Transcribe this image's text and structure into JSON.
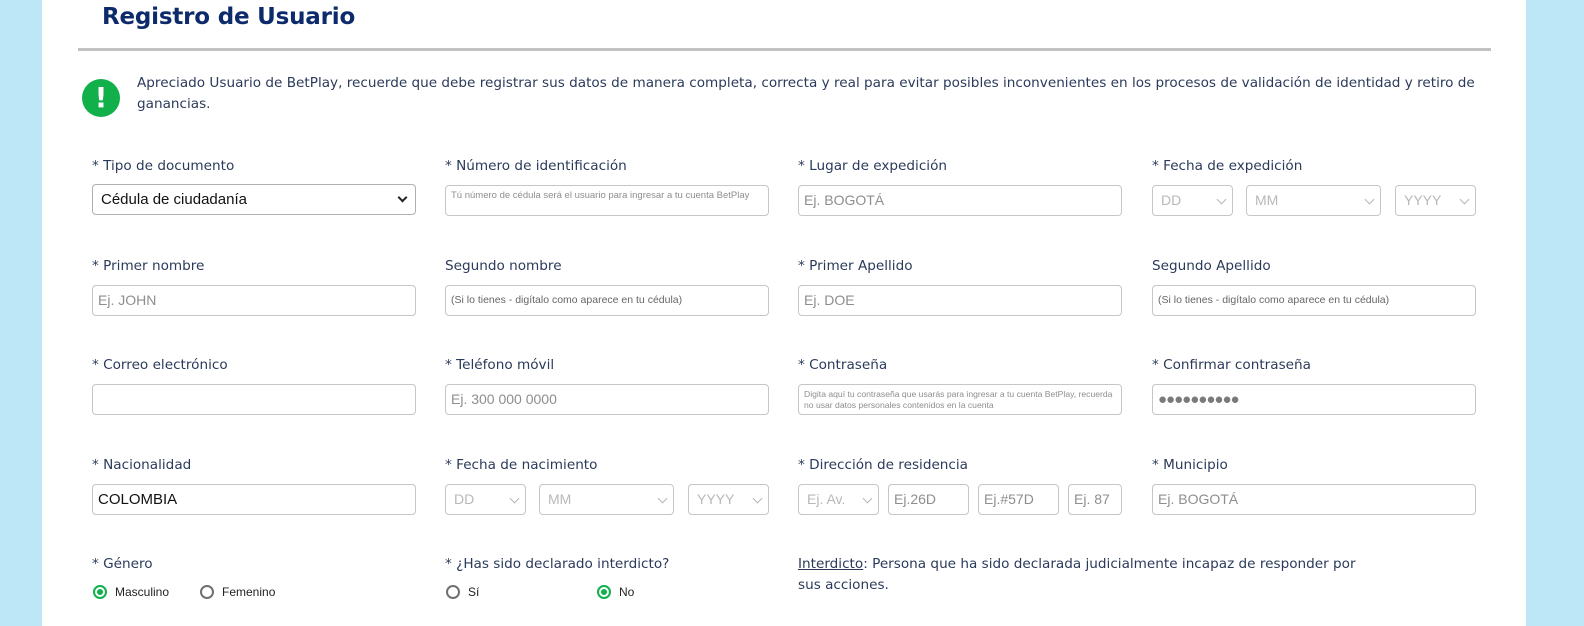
{
  "header": {
    "title": "Registro de Usuario"
  },
  "alert": {
    "icon": "exclamation-icon",
    "text": "Apreciado Usuario de BetPlay, recuerde que debe registrar sus datos de manera completa, correcta y real para evitar posibles inconvenientes en los procesos de validación de identidad y retiro de ganancias."
  },
  "colors": {
    "brand_dark_blue": "#0d2b6b",
    "accent_green": "#11b04a",
    "side_background": "#bde6f6"
  },
  "form": {
    "tipo_documento": {
      "label": "* Tipo de documento",
      "value": "Cédula de ciudadanía"
    },
    "numero_identificacion": {
      "label": "* Número de identificación",
      "placeholder": "Tú número de cédula será el usuario para ingresar a tu cuenta BetPlay"
    },
    "lugar_expedicion": {
      "label": "* Lugar de expedición",
      "placeholder": "Ej. BOGOTÁ"
    },
    "fecha_expedicion": {
      "label": "* Fecha de expedición",
      "day": "DD",
      "month": "MM",
      "year": "YYYY"
    },
    "primer_nombre": {
      "label": "* Primer nombre",
      "placeholder": "Ej. JOHN"
    },
    "segundo_nombre": {
      "label": "Segundo nombre",
      "placeholder": "(Si lo tienes - digítalo como aparece en tu cédula)"
    },
    "primer_apellido": {
      "label": "* Primer Apellido",
      "placeholder": "Ej. DOE"
    },
    "segundo_apellido": {
      "label": "Segundo Apellido",
      "placeholder": "(Si lo tienes - digítalo como aparece en tu cédula)"
    },
    "correo": {
      "label": "* Correo electrónico",
      "value": ""
    },
    "telefono": {
      "label": "* Teléfono móvil",
      "placeholder": "Ej. 300 000 0000"
    },
    "contrasena": {
      "label": "* Contraseña",
      "placeholder": "Digita aquí tu contraseña que usarás para ingresar a tu cuenta BetPlay, recuerda no usar datos personales contenidos en la cuenta"
    },
    "confirmar_contrasena": {
      "label": "* Confirmar contraseña",
      "value": "●●●●●●●●●●"
    },
    "nacionalidad": {
      "label": "* Nacionalidad",
      "value": "COLOMBIA"
    },
    "fecha_nacimiento": {
      "label": "* Fecha de nacimiento",
      "day": "DD",
      "month": "MM",
      "year": "YYYY"
    },
    "direccion": {
      "label": "* Dirección de residencia",
      "tipo_via": "Ej. Av.",
      "numero_via": "Ej.26D",
      "numero_cruce": "Ej.#57D",
      "numero_placa": "Ej. 87"
    },
    "municipio": {
      "label": "* Municipio",
      "placeholder": "Ej. BOGOTÁ"
    },
    "genero": {
      "label": "* Género",
      "options": [
        {
          "label": "Masculino",
          "checked": true
        },
        {
          "label": "Femenino",
          "checked": false
        }
      ]
    },
    "interdicto": {
      "label": "* ¿Has sido declarado interdicto?",
      "options": [
        {
          "label": "Sí",
          "checked": false
        },
        {
          "label": "No",
          "checked": true
        }
      ]
    },
    "interdicto_note": {
      "term": "Interdicto",
      "definition": ": Persona que ha sido declarada judicialmente incapaz de responder por sus acciones."
    }
  }
}
